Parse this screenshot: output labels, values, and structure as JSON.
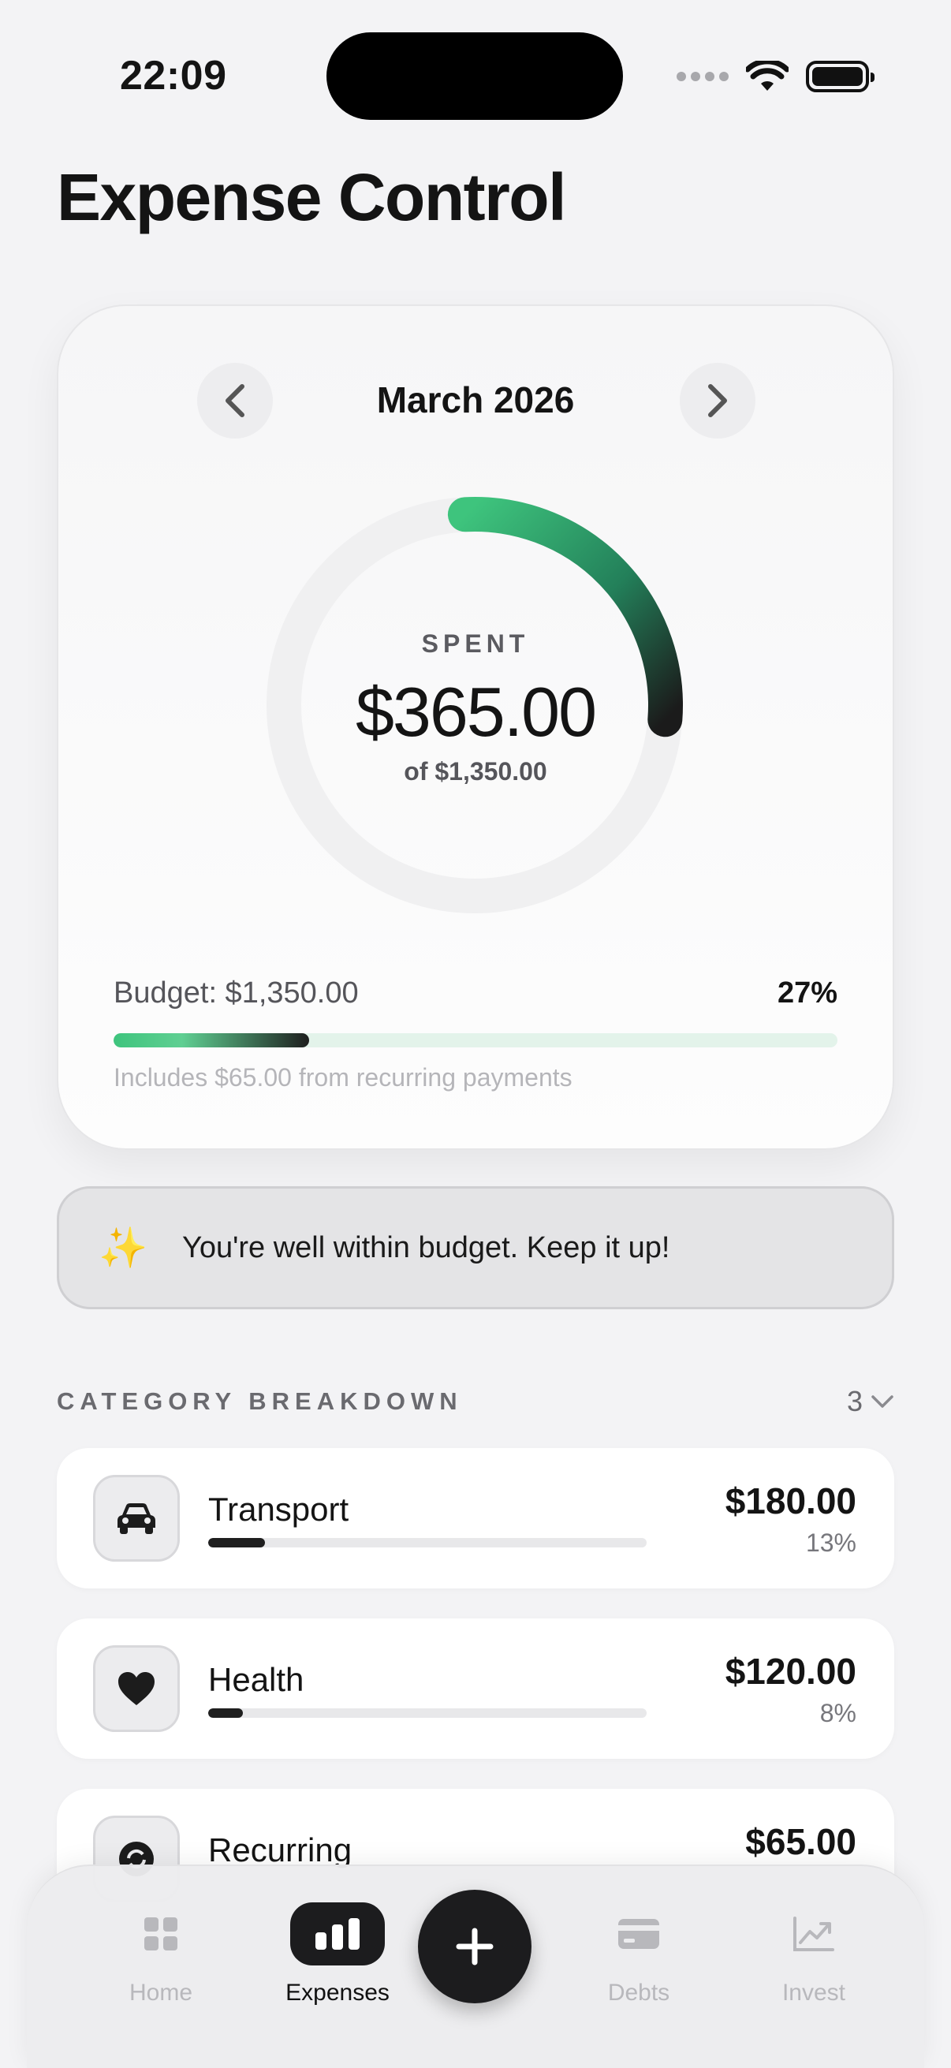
{
  "status_bar": {
    "time": "22:09"
  },
  "header": {
    "title": "Expense Control"
  },
  "summary": {
    "month": "March 2026",
    "spent_label": "SPENT",
    "spent_amount": "$365.00",
    "of_total": "of $1,350.00",
    "budget_label": "Budget: $1,350.00",
    "budget_percent": "27%",
    "budget_fraction": 0.27,
    "recurring_note": "Includes $65.00 from recurring payments",
    "accent_color": "#3ec47d"
  },
  "tip": {
    "icon": "sparkles-icon",
    "text": "You're well within budget. Keep it up!"
  },
  "categories": {
    "title": "CATEGORY BREAKDOWN",
    "count": "3",
    "items": [
      {
        "name": "Transport",
        "amount": "$180.00",
        "percent": "13%",
        "fraction": 0.13,
        "icon": "car-icon"
      },
      {
        "name": "Health",
        "amount": "$120.00",
        "percent": "8%",
        "fraction": 0.08,
        "icon": "heart-icon"
      },
      {
        "name": "Recurring",
        "amount": "$65.00",
        "percent": "",
        "fraction": 0.05,
        "icon": "recurring-icon"
      }
    ]
  },
  "tabbar": {
    "home": "Home",
    "expenses": "Expenses",
    "debts": "Debts",
    "invest": "Invest"
  }
}
